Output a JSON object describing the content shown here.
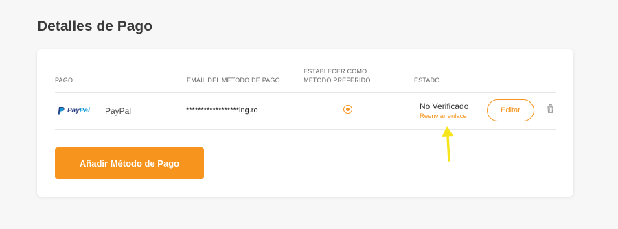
{
  "page": {
    "title": "Detalles de Pago"
  },
  "table": {
    "headers": {
      "pago": "PAGO",
      "email": "EMAIL DEL MÉTODO DE PAGO",
      "preferred_line1": "ESTABLECER COMO",
      "preferred_line2": "MÉTODO PREFERIDO",
      "estado": "ESTADO"
    },
    "rows": [
      {
        "logo_icon": "paypal-logo",
        "logo_pay": "Pay",
        "logo_pal": "Pal",
        "name": "PayPal",
        "email": "******************ing.ro",
        "preferred": true,
        "status": "No Verificado",
        "resend_link": "Reenviar enlace",
        "edit_label": "Editar",
        "delete_icon": "trash-icon"
      }
    ]
  },
  "actions": {
    "add_label": "Añadir Método de Pago"
  },
  "colors": {
    "accent": "#f7941d",
    "paypal_dark": "#253b80",
    "paypal_light": "#179bd7",
    "annotation": "#f5e51a"
  }
}
